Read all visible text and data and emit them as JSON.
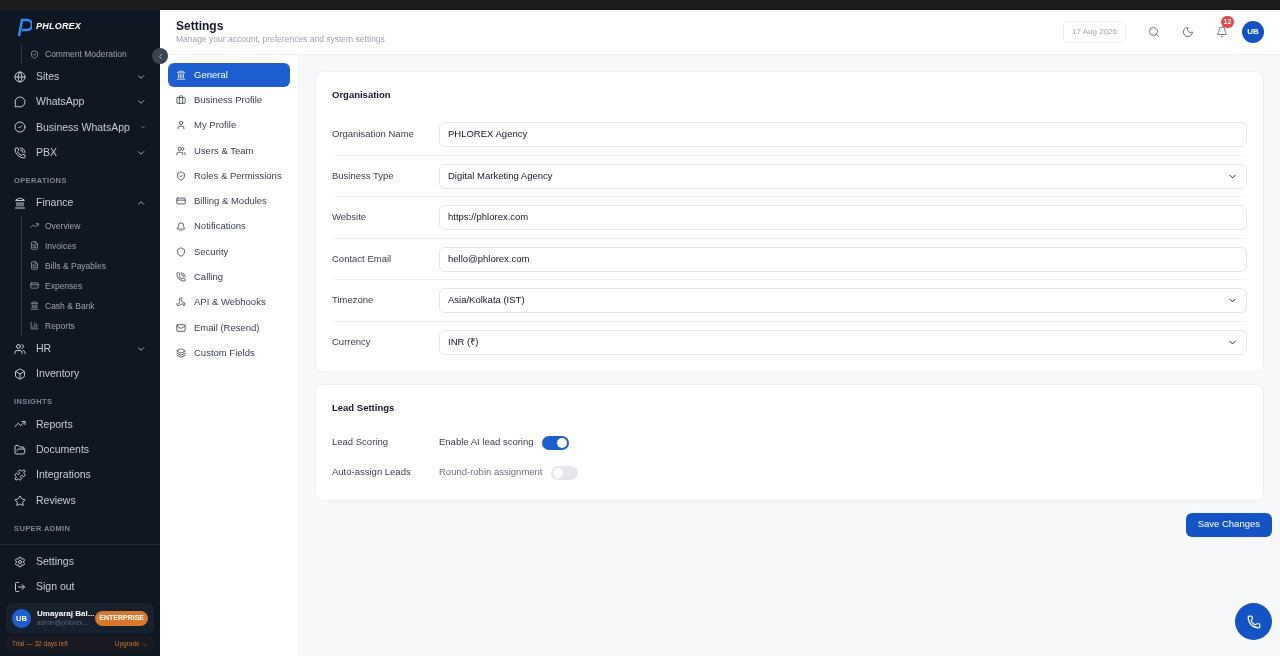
{
  "brand": {
    "logo_text": "PHLOREX"
  },
  "sidebar": {
    "items": [
      {
        "kind": "sub",
        "label": "Comment Moderation"
      },
      {
        "kind": "item",
        "label": "Sites",
        "expanded": false
      },
      {
        "kind": "item",
        "label": "WhatsApp",
        "expanded": false
      },
      {
        "kind": "item",
        "label": "Business WhatsApp",
        "expanded": false
      },
      {
        "kind": "item",
        "label": "PBX",
        "expanded": false
      },
      {
        "kind": "section",
        "label": "OPERATIONS"
      },
      {
        "kind": "item",
        "label": "Finance",
        "expanded": true
      },
      {
        "kind": "sub",
        "label": "Overview"
      },
      {
        "kind": "sub",
        "label": "Invoices"
      },
      {
        "kind": "sub",
        "label": "Bills & Payables"
      },
      {
        "kind": "sub",
        "label": "Expenses"
      },
      {
        "kind": "sub",
        "label": "Cash & Bank"
      },
      {
        "kind": "sub",
        "label": "Reports"
      },
      {
        "kind": "item",
        "label": "HR",
        "expanded": false
      },
      {
        "kind": "item",
        "label": "Inventory"
      },
      {
        "kind": "section",
        "label": "INSIGHTS"
      },
      {
        "kind": "item",
        "label": "Reports"
      },
      {
        "kind": "item",
        "label": "Documents"
      },
      {
        "kind": "item",
        "label": "Integrations"
      },
      {
        "kind": "item",
        "label": "Reviews"
      },
      {
        "kind": "section",
        "label": "SUPER ADMIN"
      }
    ],
    "footer_items": [
      "Settings",
      "Sign out"
    ],
    "user": {
      "initials": "UB",
      "name": "Umayaraj Bal...",
      "email": "admin@phlorex....",
      "plan": "ENTERPRISE"
    },
    "trial": {
      "text": "Trial — 32 days left",
      "link": "Upgrade →"
    }
  },
  "header": {
    "title": "Settings",
    "subtitle": "Manage your account, preferences and system settings",
    "date": "17 Aug 2026",
    "notifications": "12",
    "avatar": "UB"
  },
  "settings_nav": [
    {
      "label": "General",
      "selected": true
    },
    {
      "label": "Business Profile",
      "selected": false
    },
    {
      "label": "My Profile",
      "selected": false
    },
    {
      "label": "Users & Team",
      "selected": false
    },
    {
      "label": "Roles & Permissions",
      "selected": false
    },
    {
      "label": "Billing & Modules",
      "selected": false
    },
    {
      "label": "Notifications",
      "selected": false
    },
    {
      "label": "Security",
      "selected": false
    },
    {
      "label": "Calling",
      "selected": false
    },
    {
      "label": "API & Webhooks",
      "selected": false
    },
    {
      "label": "Email (Resend)",
      "selected": false
    },
    {
      "label": "Custom Fields",
      "selected": false
    }
  ],
  "organisation": {
    "title": "Organisation",
    "fields": [
      {
        "kind": "text",
        "label": "Organisation Name",
        "value": "PHLOREX Agency"
      },
      {
        "kind": "select",
        "label": "Business Type",
        "value": "Digital Marketing Agency"
      },
      {
        "kind": "text",
        "label": "Website",
        "value": "https://phlorex.com"
      },
      {
        "kind": "text",
        "label": "Contact Email",
        "value": "hello@phlorex.com"
      },
      {
        "kind": "select",
        "label": "Timezone",
        "value": "Asia/Kolkata (IST)"
      },
      {
        "kind": "select",
        "label": "Currency",
        "value": "INR (₹)"
      }
    ]
  },
  "lead_settings": {
    "title": "Lead Settings",
    "rows": [
      {
        "label": "Lead Scoring",
        "option": "Enable AI lead scoring",
        "on": true
      },
      {
        "label": "Auto-assign Leads",
        "option": "Round-robin assignment",
        "on": false
      }
    ]
  },
  "save_button": "Save Changes"
}
